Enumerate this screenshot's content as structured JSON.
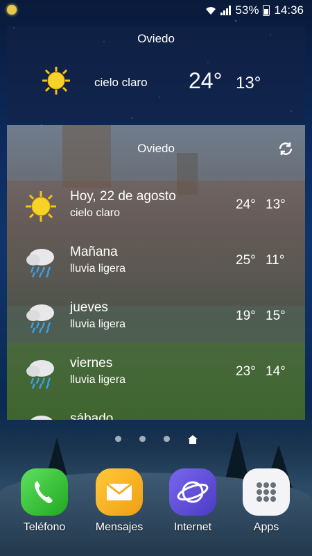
{
  "status_bar": {
    "battery": "53%",
    "time": "14:36"
  },
  "weather_top": {
    "city": "Oviedo",
    "condition": "cielo claro",
    "high": "24°",
    "low": "13°"
  },
  "forecast": {
    "city": "Oviedo",
    "rows": [
      {
        "day": "Hoy, 22 de agosto",
        "condition": "cielo claro",
        "high": "24°",
        "low": "13°",
        "icon": "sun-icon"
      },
      {
        "day": "Mañana",
        "condition": "lluvia ligera",
        "high": "25°",
        "low": "11°",
        "icon": "rain-cloud-icon"
      },
      {
        "day": "jueves",
        "condition": "lluvia ligera",
        "high": "19°",
        "low": "15°",
        "icon": "rain-cloud-icon"
      },
      {
        "day": "viernes",
        "condition": "lluvia ligera",
        "high": "23°",
        "low": "14°",
        "icon": "rain-cloud-icon"
      },
      {
        "day": "sábado",
        "condition": "",
        "high": "",
        "low": "",
        "icon": "rain-cloud-icon"
      }
    ]
  },
  "dock": {
    "apps": [
      {
        "label": "Teléfono",
        "icon": "phone-icon",
        "color": "#3cc43c"
      },
      {
        "label": "Mensajes",
        "icon": "mail-icon",
        "color": "#f2b01e"
      },
      {
        "label": "Internet",
        "icon": "browser-icon",
        "color": "#6a58d9"
      },
      {
        "label": "Apps",
        "icon": "apps-grid-icon",
        "color": "#f2f2f2"
      }
    ]
  }
}
